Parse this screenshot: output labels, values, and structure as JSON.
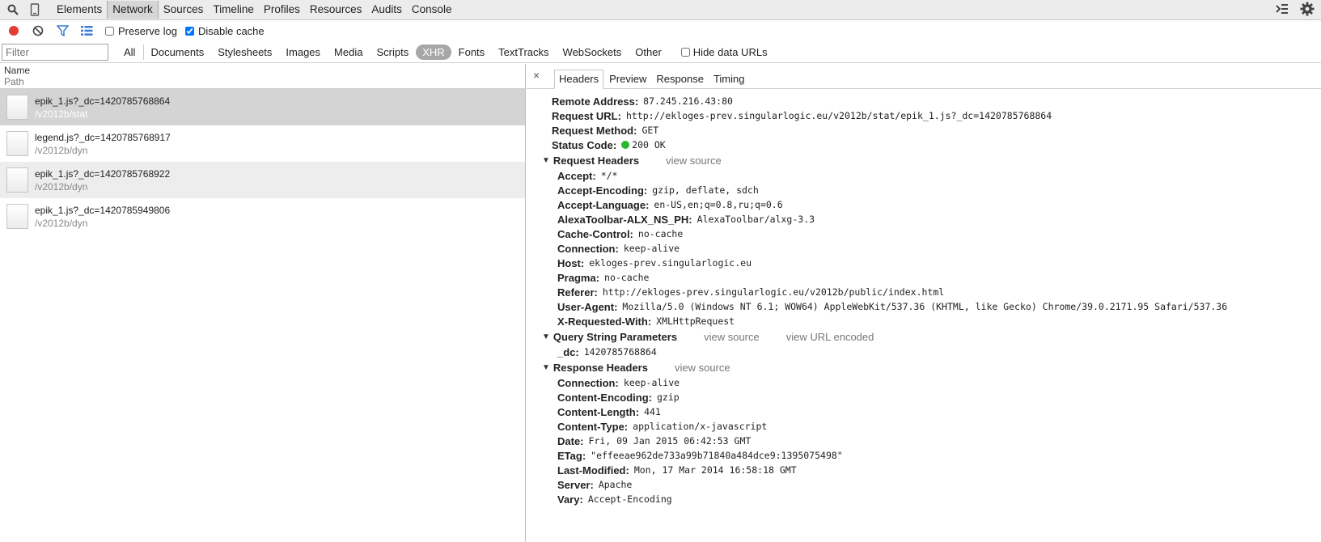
{
  "panel_tabs": [
    "Elements",
    "Network",
    "Sources",
    "Timeline",
    "Profiles",
    "Resources",
    "Audits",
    "Console"
  ],
  "toolbar": {
    "preserve_log_label": "Preserve log",
    "disable_cache_label": "Disable cache"
  },
  "filter": {
    "placeholder": "Filter",
    "types": [
      "All",
      "Documents",
      "Stylesheets",
      "Images",
      "Media",
      "Scripts",
      "XHR",
      "Fonts",
      "TextTracks",
      "WebSockets",
      "Other"
    ],
    "active_type": "XHR",
    "hide_data_urls_label": "Hide data URLs"
  },
  "list": {
    "header_name": "Name",
    "header_path": "Path",
    "rows": [
      {
        "name": "epik_1.js?_dc=1420785768864",
        "path": "/v2012b/stat"
      },
      {
        "name": "legend.js?_dc=1420785768917",
        "path": "/v2012b/dyn"
      },
      {
        "name": "epik_1.js?_dc=1420785768922",
        "path": "/v2012b/dyn"
      },
      {
        "name": "epik_1.js?_dc=1420785949806",
        "path": "/v2012b/dyn"
      }
    ]
  },
  "detail": {
    "close": "×",
    "tabs": [
      "Headers",
      "Preview",
      "Response",
      "Timing"
    ],
    "general": [
      {
        "k": "Remote Address:",
        "v": "87.245.216.43:80"
      },
      {
        "k": "Request URL:",
        "v": "http://ekloges-prev.singularlogic.eu/v2012b/stat/epik_1.js?_dc=1420785768864"
      },
      {
        "k": "Request Method:",
        "v": "GET"
      },
      {
        "k": "Status Code:",
        "v": "200 OK"
      }
    ],
    "request_headers_title": "Request Headers",
    "request_headers_link": "view source",
    "request_headers": [
      {
        "k": "Accept:",
        "v": "*/*"
      },
      {
        "k": "Accept-Encoding:",
        "v": "gzip, deflate, sdch"
      },
      {
        "k": "Accept-Language:",
        "v": "en-US,en;q=0.8,ru;q=0.6"
      },
      {
        "k": "AlexaToolbar-ALX_NS_PH:",
        "v": "AlexaToolbar/alxg-3.3"
      },
      {
        "k": "Cache-Control:",
        "v": "no-cache"
      },
      {
        "k": "Connection:",
        "v": "keep-alive"
      },
      {
        "k": "Host:",
        "v": "ekloges-prev.singularlogic.eu"
      },
      {
        "k": "Pragma:",
        "v": "no-cache"
      },
      {
        "k": "Referer:",
        "v": "http://ekloges-prev.singularlogic.eu/v2012b/public/index.html"
      },
      {
        "k": "User-Agent:",
        "v": "Mozilla/5.0 (Windows NT 6.1; WOW64) AppleWebKit/537.36 (KHTML, like Gecko) Chrome/39.0.2171.95 Safari/537.36"
      },
      {
        "k": "X-Requested-With:",
        "v": "XMLHttpRequest"
      }
    ],
    "query_title": "Query String Parameters",
    "query_link1": "view source",
    "query_link2": "view URL encoded",
    "query": [
      {
        "k": "_dc:",
        "v": "1420785768864"
      }
    ],
    "response_headers_title": "Response Headers",
    "response_headers_link": "view source",
    "response_headers": [
      {
        "k": "Connection:",
        "v": "keep-alive"
      },
      {
        "k": "Content-Encoding:",
        "v": "gzip"
      },
      {
        "k": "Content-Length:",
        "v": "441"
      },
      {
        "k": "Content-Type:",
        "v": "application/x-javascript"
      },
      {
        "k": "Date:",
        "v": "Fri, 09 Jan 2015 06:42:53 GMT"
      },
      {
        "k": "ETag:",
        "v": "\"effeeae962de733a99b71840a484dce9:1395075498\""
      },
      {
        "k": "Last-Modified:",
        "v": "Mon, 17 Mar 2014 16:58:18 GMT"
      },
      {
        "k": "Server:",
        "v": "Apache"
      },
      {
        "k": "Vary:",
        "v": "Accept-Encoding"
      }
    ]
  },
  "colors": {
    "record_red": "#e23c35",
    "filter_blue": "#3a7bd5",
    "status_green": "#27b82b",
    "active_pill": "#a7a7a7"
  }
}
